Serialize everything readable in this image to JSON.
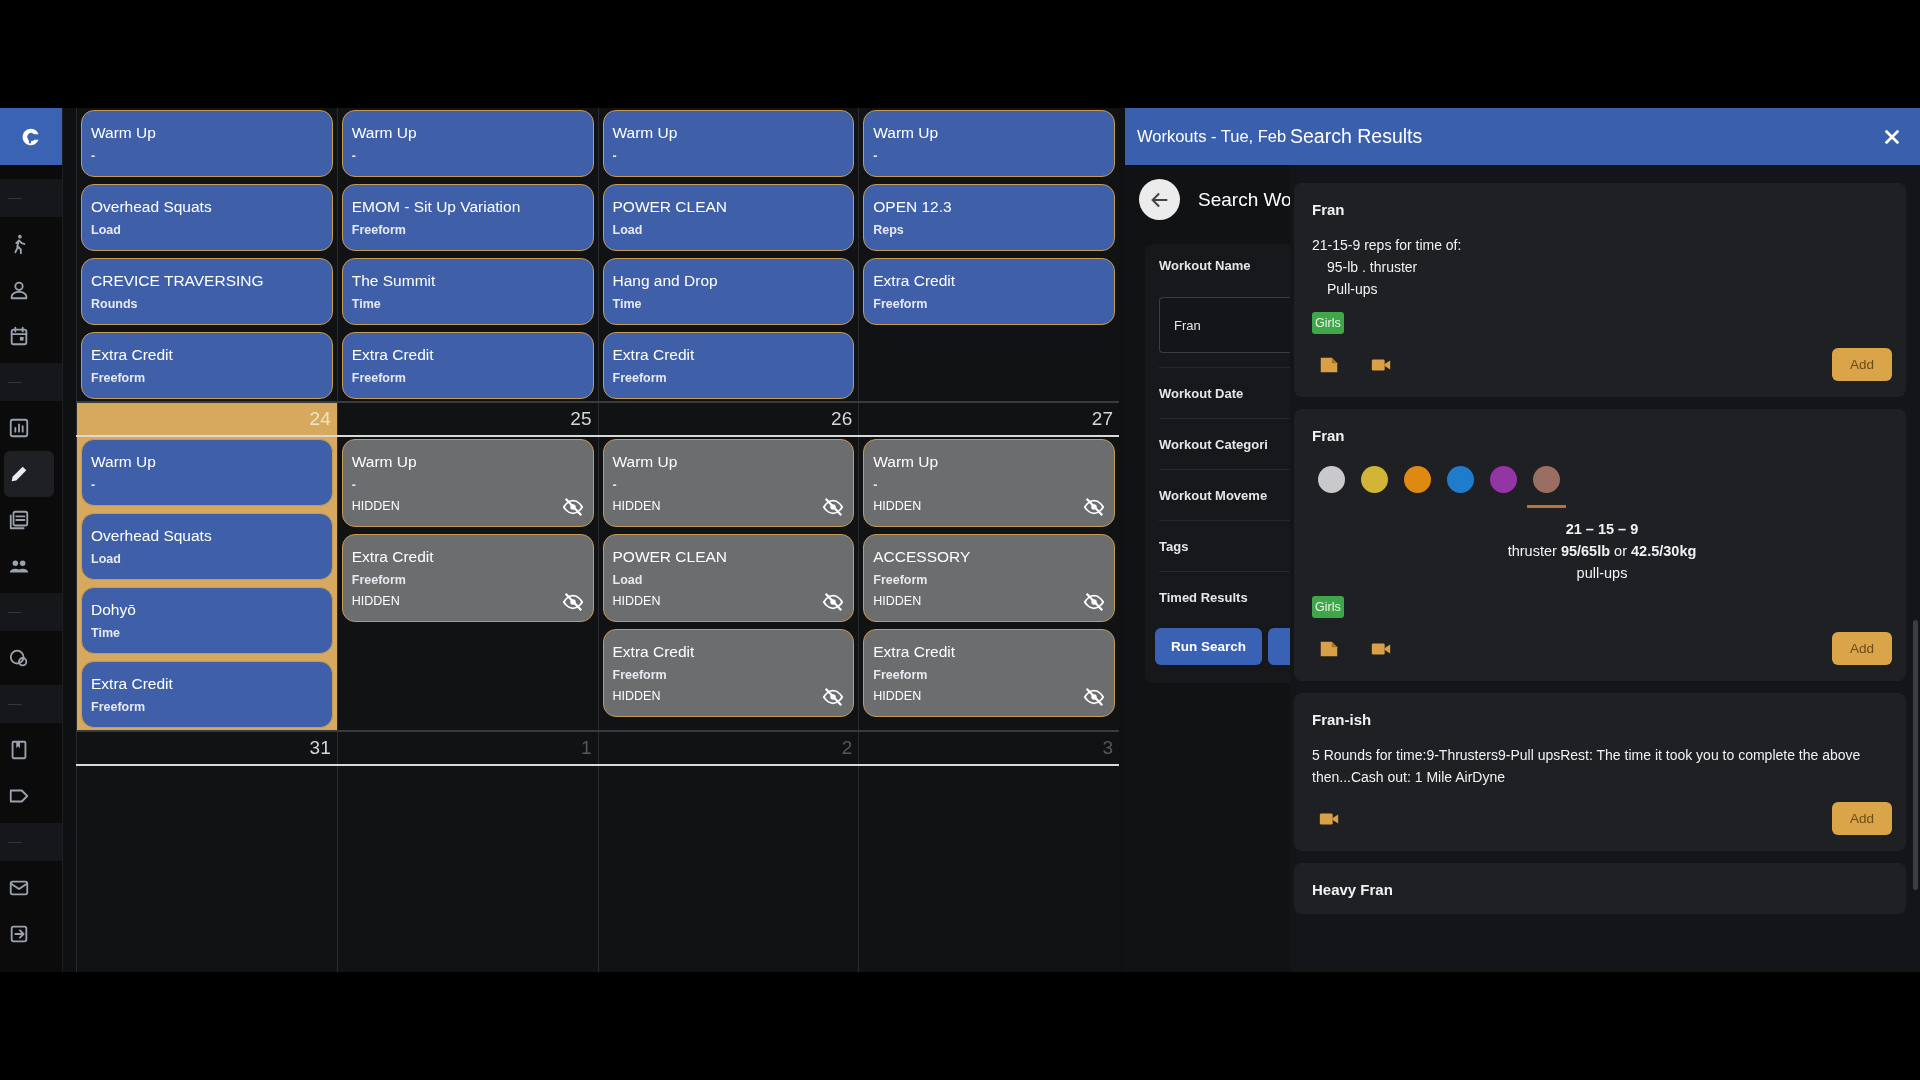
{
  "sidebar": {
    "items": [
      {
        "kind": "divider"
      },
      {
        "kind": "icon",
        "selected": false
      },
      {
        "kind": "icon",
        "selected": false
      },
      {
        "kind": "icon",
        "selected": false
      },
      {
        "kind": "divider"
      },
      {
        "kind": "icon",
        "selected": false
      },
      {
        "kind": "icon",
        "selected": true
      },
      {
        "kind": "icon",
        "selected": false
      },
      {
        "kind": "icon",
        "selected": false
      },
      {
        "kind": "divider"
      },
      {
        "kind": "icon",
        "selected": false
      },
      {
        "kind": "divider"
      },
      {
        "kind": "icon",
        "selected": false
      },
      {
        "kind": "icon",
        "selected": false
      },
      {
        "kind": "divider"
      },
      {
        "kind": "icon",
        "selected": false
      },
      {
        "kind": "icon",
        "selected": false
      }
    ]
  },
  "calendar": {
    "weeks": [
      {
        "days": [
          {
            "workouts": [
              {
                "name": "Warm Up",
                "type": "-",
                "hidden": false
              },
              {
                "name": "Overhead Squats",
                "type": "Load",
                "hidden": false
              },
              {
                "name": "CREVICE TRAVERSING",
                "type": "Rounds",
                "hidden": false
              },
              {
                "name": "Extra Credit",
                "type": "Freeform",
                "hidden": false
              }
            ]
          },
          {
            "workouts": [
              {
                "name": "Warm Up",
                "type": "-",
                "hidden": false
              },
              {
                "name": "EMOM - Sit Up Variation",
                "type": "Freeform",
                "hidden": false
              },
              {
                "name": "The Summit",
                "type": "Time",
                "hidden": false
              },
              {
                "name": "Extra Credit",
                "type": "Freeform",
                "hidden": false
              }
            ]
          },
          {
            "workouts": [
              {
                "name": "Warm Up",
                "type": "-",
                "hidden": false
              },
              {
                "name": "POWER CLEAN",
                "type": "Load",
                "hidden": false
              },
              {
                "name": "Hang and Drop",
                "type": "Time",
                "hidden": false
              },
              {
                "name": "Extra Credit",
                "type": "Freeform",
                "hidden": false
              }
            ]
          },
          {
            "workouts": [
              {
                "name": "Warm Up",
                "type": "-",
                "hidden": false
              },
              {
                "name": "OPEN 12.3",
                "type": "Reps",
                "hidden": false
              },
              {
                "name": "Extra Credit",
                "type": "Freeform",
                "hidden": false
              }
            ]
          }
        ]
      },
      {
        "days": [
          {
            "date": "24",
            "today": true,
            "other_month": false,
            "workouts": [
              {
                "name": "Warm Up",
                "type": "-",
                "hidden": false
              },
              {
                "name": "Overhead Squats",
                "type": "Load",
                "hidden": false
              },
              {
                "name": "Dohyō",
                "type": "Time",
                "hidden": false
              },
              {
                "name": "Extra Credit",
                "type": "Freeform",
                "hidden": false
              }
            ]
          },
          {
            "date": "25",
            "today": false,
            "other_month": false,
            "workouts": [
              {
                "name": "Warm Up",
                "type": "-",
                "hidden": true,
                "status": "HIDDEN"
              },
              {
                "name": "Extra Credit",
                "type": "Freeform",
                "hidden": true,
                "status": "HIDDEN"
              }
            ]
          },
          {
            "date": "26",
            "today": false,
            "other_month": false,
            "workouts": [
              {
                "name": "Warm Up",
                "type": "-",
                "hidden": true,
                "status": "HIDDEN"
              },
              {
                "name": "POWER CLEAN",
                "type": "Load",
                "hidden": true,
                "status": "HIDDEN"
              },
              {
                "name": "Extra Credit",
                "type": "Freeform",
                "hidden": true,
                "status": "HIDDEN"
              }
            ]
          },
          {
            "date": "27",
            "today": false,
            "other_month": false,
            "workouts": [
              {
                "name": "Warm Up",
                "type": "-",
                "hidden": true,
                "status": "HIDDEN"
              },
              {
                "name": "ACCESSORY",
                "type": "Freeform",
                "hidden": true,
                "status": "HIDDEN"
              },
              {
                "name": "Extra Credit",
                "type": "Freeform",
                "hidden": true,
                "status": "HIDDEN"
              }
            ]
          }
        ]
      },
      {
        "days": [
          {
            "date": "31",
            "today": false,
            "other_month": false
          },
          {
            "date": "1",
            "today": false,
            "other_month": true
          },
          {
            "date": "2",
            "today": false,
            "other_month": true
          },
          {
            "date": "3",
            "today": false,
            "other_month": true
          }
        ]
      }
    ]
  },
  "panel": {
    "title": "Workouts - Tue, Feb",
    "results_title": "Search Results",
    "search_form": {
      "title": "Search Wo",
      "name_label": "Workout Name",
      "name_value": "Fran",
      "sections": [
        "Workout Date",
        "Workout Categori",
        "Workout Moveme",
        "Tags",
        "Timed Results"
      ],
      "button": "Run Search"
    },
    "results": [
      {
        "title": "Fran",
        "lines": [
          {
            "text": "21-15-9 reps for time of:",
            "indent": false
          },
          {
            "text": "95-lb . thruster",
            "indent": true
          },
          {
            "text": "Pull-ups",
            "indent": true
          }
        ],
        "tags": [
          "Girls"
        ],
        "attachments": [
          {
            "kind": "note"
          },
          {
            "kind": "video"
          }
        ],
        "button": "Add"
      },
      {
        "title": "Fran",
        "colors": [
          {
            "color": "#c9c9cc",
            "selected": false
          },
          {
            "color": "#d2b536",
            "selected": false
          },
          {
            "color": "#de8a12",
            "selected": false
          },
          {
            "color": "#1f7ccc",
            "selected": false
          },
          {
            "color": "#9435a6",
            "selected": false
          },
          {
            "color": "#9a6e62",
            "selected": true
          }
        ],
        "centered": [
          {
            "text": "21 – 15 – 9",
            "kind": "heading"
          },
          {
            "text": "thruster **95/65lb** or **42.5/30kg**",
            "kind": "line"
          },
          {
            "text": "pull-ups",
            "kind": "line"
          }
        ],
        "tags": [
          "Girls"
        ],
        "attachments": [
          {
            "kind": "note"
          },
          {
            "kind": "video"
          }
        ],
        "button": "Add"
      },
      {
        "title": "Fran-ish",
        "lines": [
          {
            "text": "5 Rounds for time:9-Thrusters9-Pull upsRest: The time it took you to complete the above then...Cash out: 1 Mile AirDyne",
            "indent": false
          }
        ],
        "attachments": [
          {
            "kind": "video"
          }
        ],
        "button": "Add"
      },
      {
        "title": "Heavy Fran"
      }
    ]
  }
}
